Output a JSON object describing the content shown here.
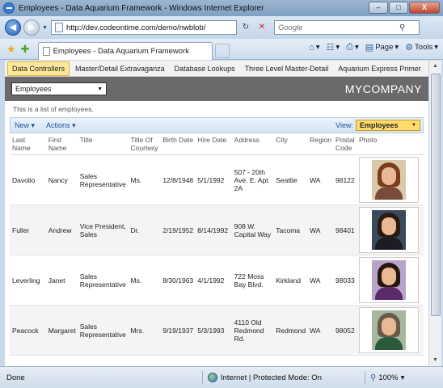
{
  "window": {
    "title": "Employees - Data Aquarium Framework - Windows Internet Explorer",
    "minimize": "–",
    "maximize": "□",
    "close": "X"
  },
  "address": {
    "url": "http://dev.codeontime.com/demo/nwblob/",
    "search_placeholder": "Google"
  },
  "tab": {
    "title": "Employees - Data Aquarium Framework"
  },
  "commands": {
    "page": "Page",
    "tools": "Tools"
  },
  "menu": [
    {
      "label": "Data Controllers",
      "active": true
    },
    {
      "label": "Master/Detail Extravaganza",
      "active": false
    },
    {
      "label": "Database Lookups",
      "active": false
    },
    {
      "label": "Three Level Master-Detail",
      "active": false
    },
    {
      "label": "Aquarium Express Primer",
      "active": false
    }
  ],
  "banner": {
    "controller_select": "Employees",
    "company": "MYCOMPANY"
  },
  "description": "This is a list of employees.",
  "actions": {
    "new": "New",
    "actions": "Actions",
    "view_label": "View:",
    "view_value": "Employees"
  },
  "columns": [
    "Last Name",
    "First Name",
    "Title",
    "Title Of Courtesy",
    "Birth Date",
    "Hire Date",
    "Address",
    "City",
    "Region",
    "Postal Code",
    "Photo"
  ],
  "rows": [
    {
      "last": "Davolio",
      "first": "Nancy",
      "title": "Sales Representative",
      "courtesy": "Ms.",
      "birth": "12/8/1948",
      "hire": "5/1/1992",
      "address": "507 - 20th Ave. E. Apt. 2A",
      "city": "Seattle",
      "region": "WA",
      "postal": "98122"
    },
    {
      "last": "Fuller",
      "first": "Andrew",
      "title": "Vice President, Sales",
      "courtesy": "Dr.",
      "birth": "2/19/1952",
      "hire": "8/14/1992",
      "address": "908 W. Capital Way",
      "city": "Tacoma",
      "region": "WA",
      "postal": "98401"
    },
    {
      "last": "Leverling",
      "first": "Janet",
      "title": "Sales Representative",
      "courtesy": "Ms.",
      "birth": "8/30/1963",
      "hire": "4/1/1992",
      "address": "722 Moss Bay Blvd.",
      "city": "Kirkland",
      "region": "WA",
      "postal": "98033"
    },
    {
      "last": "Peacock",
      "first": "Margaret",
      "title": "Sales Representative",
      "courtesy": "Mrs.",
      "birth": "9/19/1937",
      "hire": "5/3/1993",
      "address": "4110 Old Redmond Rd.",
      "city": "Redmond",
      "region": "WA",
      "postal": "98052"
    }
  ],
  "status": {
    "done": "Done",
    "zone": "Internet | Protected Mode: On",
    "zoom": "100%"
  }
}
